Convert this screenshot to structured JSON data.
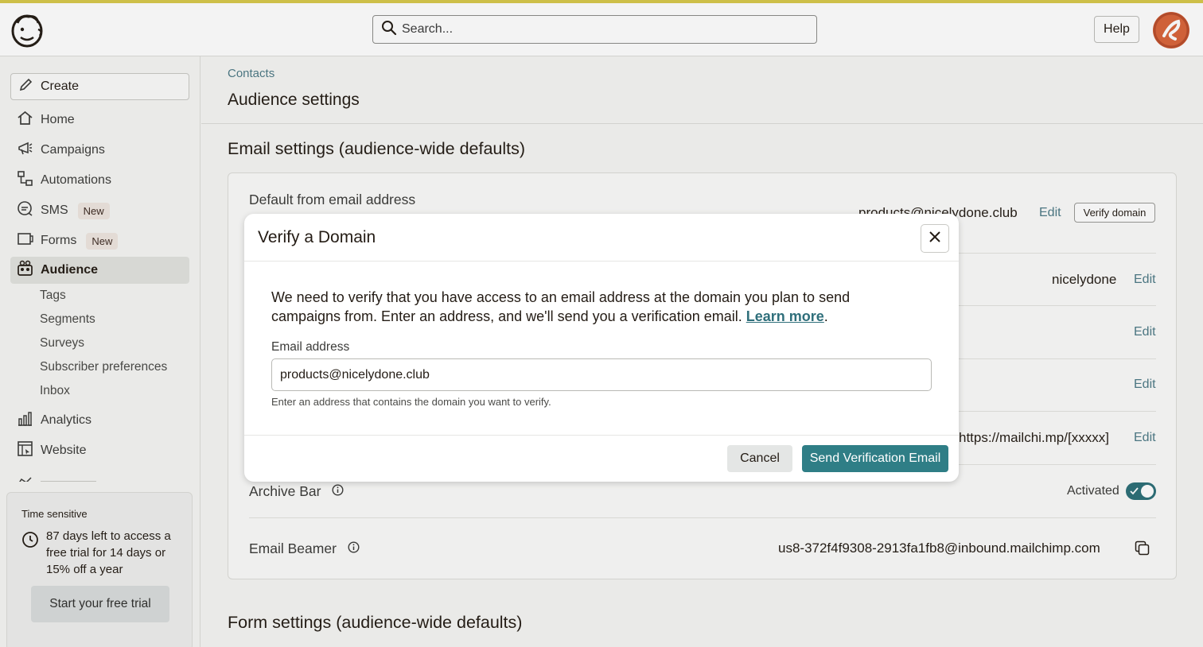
{
  "header": {
    "search_placeholder": "Search...",
    "help_label": "Help",
    "logo_icon": "mailchimp-freddie-icon",
    "avatar_icon": "user-avatar-icon"
  },
  "sidebar": {
    "create_label": "Create",
    "items": [
      {
        "label": "Home",
        "icon": "home-icon"
      },
      {
        "label": "Campaigns",
        "icon": "megaphone-icon"
      },
      {
        "label": "Automations",
        "icon": "automations-icon"
      },
      {
        "label": "SMS",
        "icon": "chat-bubble-icon",
        "badge": "New"
      },
      {
        "label": "Forms",
        "icon": "forms-icon",
        "badge": "New"
      },
      {
        "label": "Audience",
        "icon": "audience-icon",
        "active": true
      }
    ],
    "audience_sub": [
      "Tags",
      "Segments",
      "Surveys",
      "Subscriber preferences",
      "Inbox"
    ],
    "more_items": [
      {
        "label": "Analytics",
        "icon": "bar-chart-icon"
      },
      {
        "label": "Website",
        "icon": "website-icon"
      }
    ],
    "trial": {
      "label": "Time sensitive",
      "text": "87 days left to access a free trial for 14 days or 15% off a year",
      "button": "Start your free trial"
    }
  },
  "main": {
    "breadcrumb": "Contacts",
    "title": "Audience settings",
    "email_section_title": "Email settings (audience-wide defaults)",
    "form_section_title": "Form settings (audience-wide defaults)",
    "rows": {
      "from_email_label": "Default from email address",
      "from_email_value": "products@nicelydone.club",
      "verify_domain": "Verify domain",
      "from_name_value": "nicelydone",
      "url_value": "https://mailchi.mp/[xxxxx]",
      "archive_label": "Archive Bar",
      "archive_status": "Activated",
      "beamer_label": "Email Beamer",
      "beamer_value": "us8-372f4f9308-2913fa1fb8@inbound.mailchimp.com",
      "edit_label": "Edit"
    }
  },
  "modal": {
    "title": "Verify a Domain",
    "body": "We need to verify that you have access to an email address at the domain you plan to send campaigns from. Enter an address, and we'll send you a verification email.",
    "learn_more": "Learn more",
    "field_label": "Email address",
    "field_value": "products@nicelydone.club",
    "hint": "Enter an address that contains the domain you want to verify.",
    "cancel": "Cancel",
    "send": "Send Verification Email"
  },
  "colors": {
    "accent": "#2f7e86",
    "link": "#4d7a86",
    "avatar": "#d9643a",
    "top_stripe": "#d7c84a"
  }
}
